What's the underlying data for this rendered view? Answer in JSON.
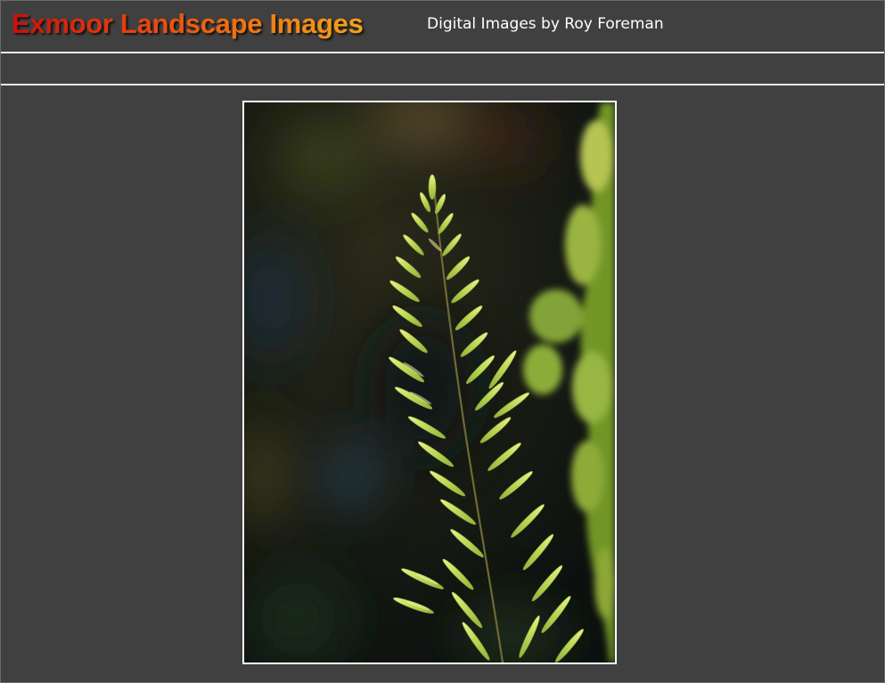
{
  "header": {
    "title": "Exmoor Landscape Images",
    "subtitle": "Digital Images by Roy Foreman"
  },
  "colors": {
    "background": "#404040",
    "title_gradient_start": "#c8100c",
    "title_gradient_end": "#f5a418",
    "subtitle": "#ffffff",
    "rule": "#e8e8e8",
    "photo_border": "#ffffff"
  },
  "photo": {
    "subject": "heather-sprig-photo"
  }
}
